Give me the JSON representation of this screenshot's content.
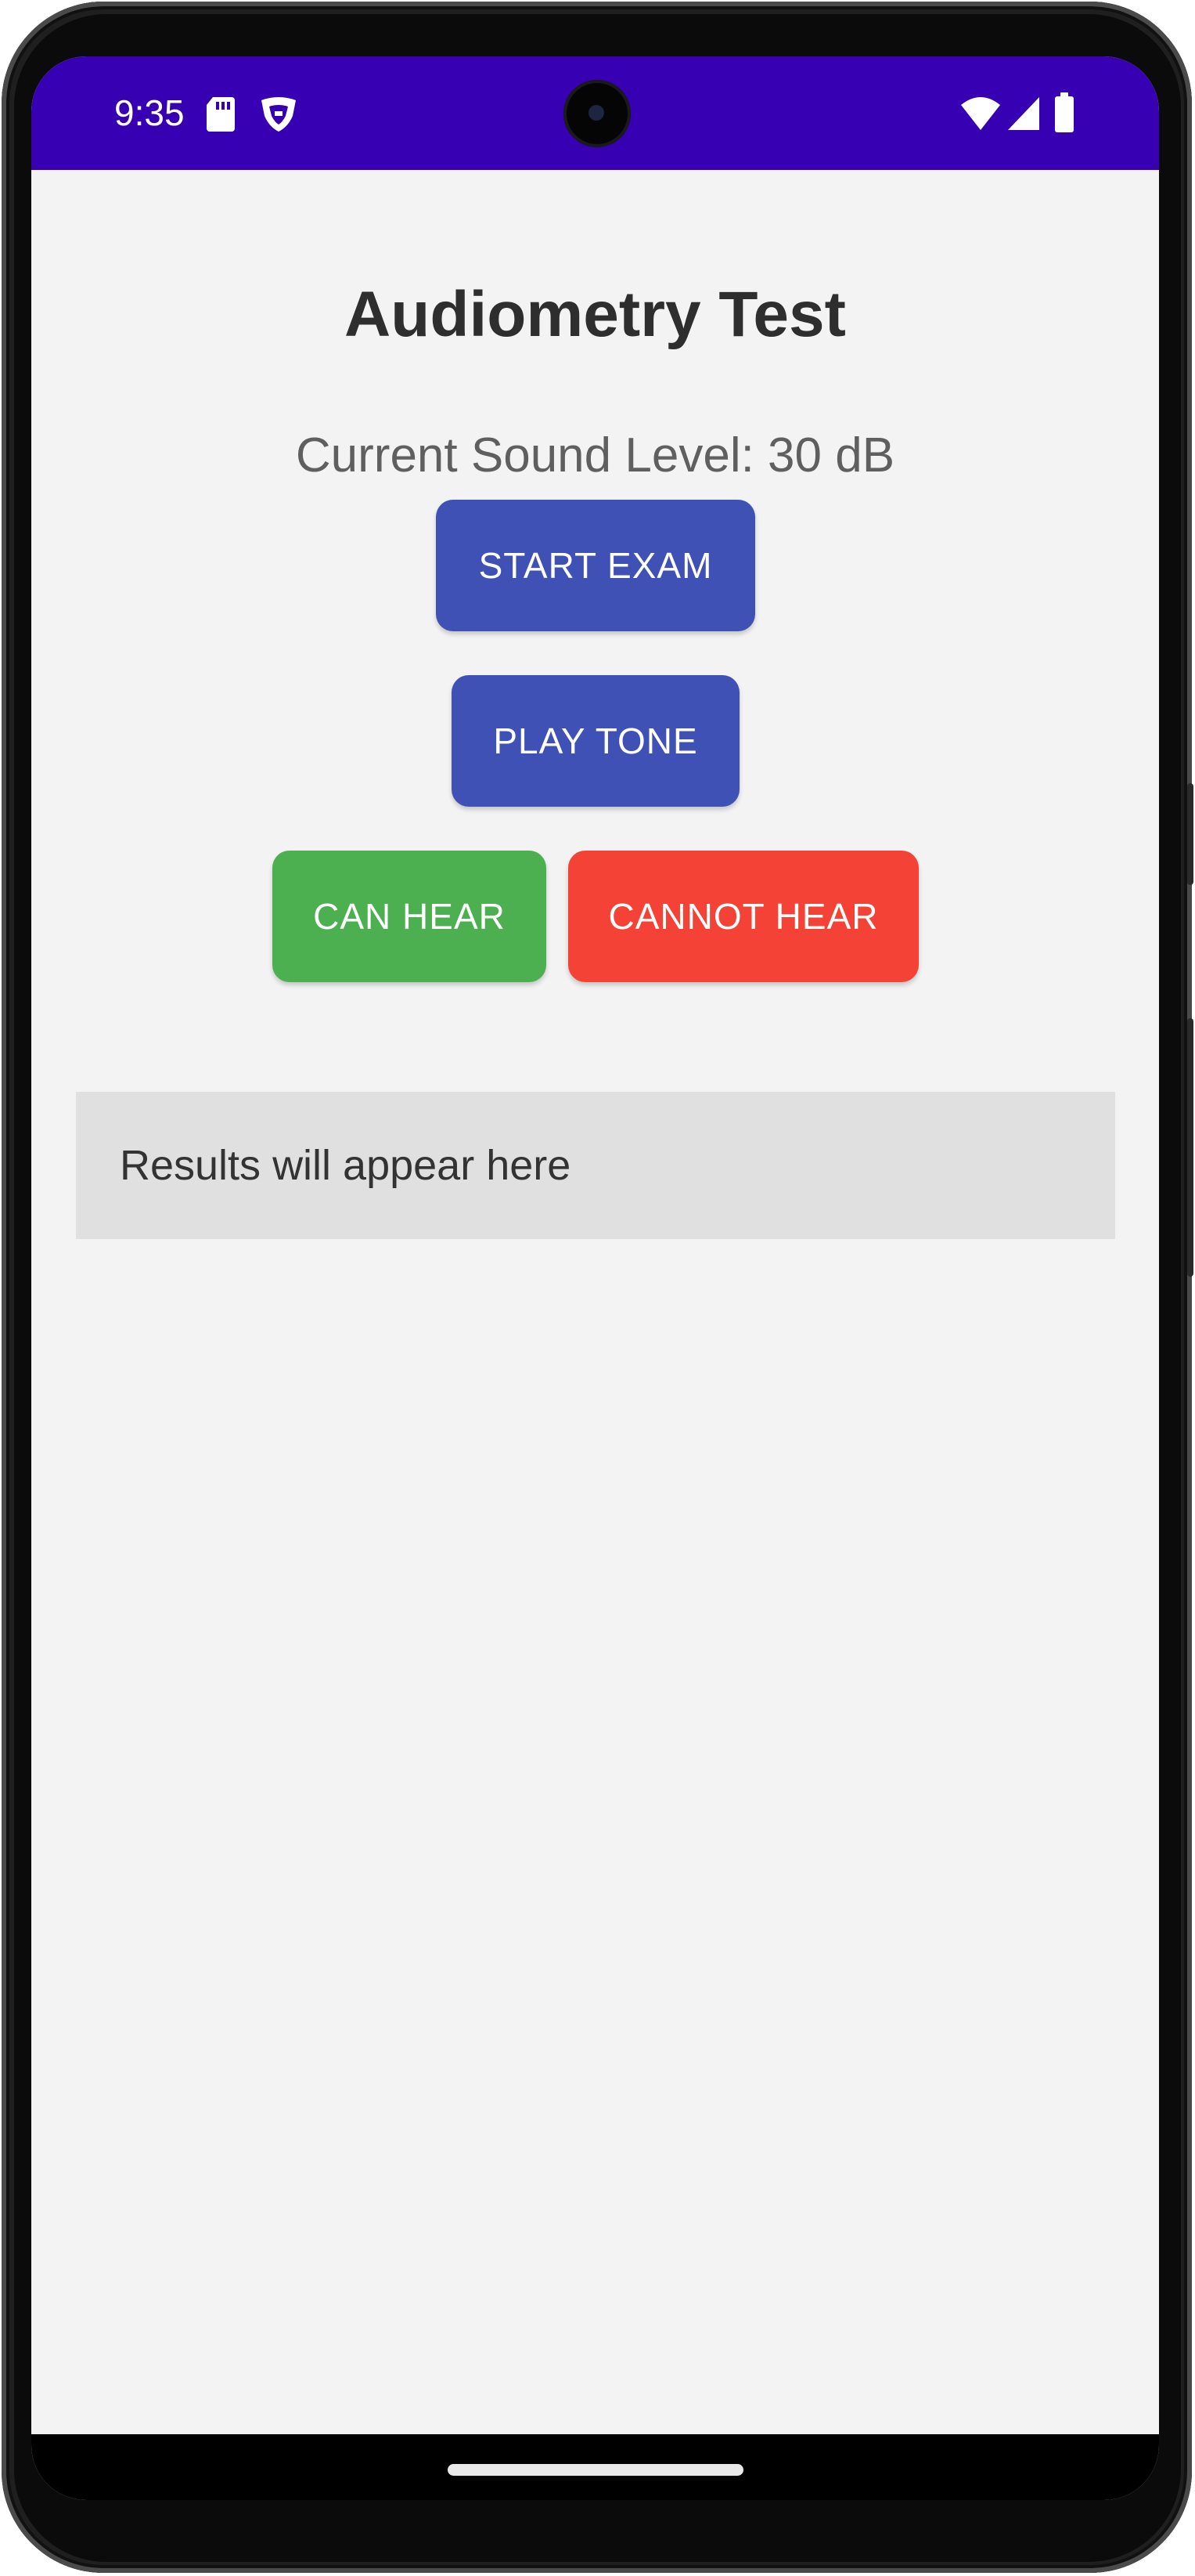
{
  "status_bar": {
    "time": "9:35",
    "background_color": "#3700b3",
    "left_icons": [
      "sd-card-icon",
      "shield-icon"
    ],
    "right_icons": [
      "wifi-icon",
      "signal-icon",
      "battery-icon"
    ]
  },
  "app": {
    "title": "Audiometry Test",
    "sound_level_text": "Current Sound Level: 30 dB",
    "background_color": "#f3f3f3"
  },
  "buttons": {
    "start_exam": {
      "label": "START EXAM",
      "color": "#3f51b5"
    },
    "play_tone": {
      "label": "PLAY TONE",
      "color": "#3f51b5"
    },
    "can_hear": {
      "label": "CAN HEAR",
      "color": "#4caf50"
    },
    "cannot_hear": {
      "label": "CANNOT HEAR",
      "color": "#f44336"
    }
  },
  "results": {
    "text": "Results will appear here",
    "background_color": "#e0e0e0"
  }
}
